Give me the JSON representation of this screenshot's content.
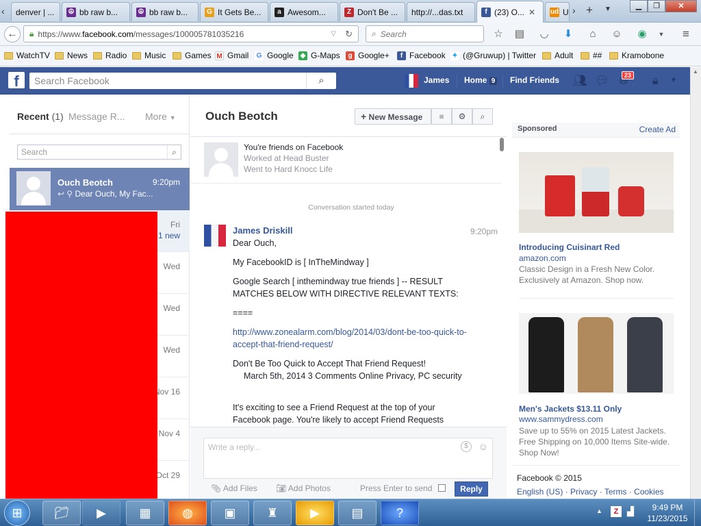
{
  "browser": {
    "tabs": [
      {
        "label": "denver | ...",
        "icon": "page-icon",
        "color": "#e06b2a"
      },
      {
        "label": "bb raw b...",
        "icon": "peace-icon",
        "color": "#6a2c91"
      },
      {
        "label": "bb raw b...",
        "icon": "peace-icon",
        "color": "#6a2c91"
      },
      {
        "label": "It Gets Be...",
        "icon": "g-icon",
        "color": "#e8a11c"
      },
      {
        "label": "Awesom...",
        "icon": "amazon-icon",
        "color": "#222222"
      },
      {
        "label": "Don't Be ...",
        "icon": "z-icon",
        "color": "#c0272d"
      },
      {
        "label": "http://...das.txt",
        "icon": "page-icon",
        "color": "#777777"
      },
      {
        "label": "(23) O...",
        "icon": "facebook-icon",
        "color": "#3b5998"
      },
      {
        "label": "U",
        "icon": "ud-icon",
        "color": "#f08a00"
      }
    ],
    "url_prefix": "https://www.",
    "url_domain": "facebook.com",
    "url_path": "/messages/100005781035216",
    "search_placeholder": "Search",
    "bookmarks": [
      {
        "label": "WatchTV",
        "icon": "folder-icon"
      },
      {
        "label": "News",
        "icon": "folder-icon"
      },
      {
        "label": "Radio",
        "icon": "folder-icon"
      },
      {
        "label": "Music",
        "icon": "folder-icon"
      },
      {
        "label": "Games",
        "icon": "folder-icon"
      },
      {
        "label": "Gmail",
        "icon": "gmail-icon"
      },
      {
        "label": "Google",
        "icon": "google-icon"
      },
      {
        "label": "G-Maps",
        "icon": "maps-icon"
      },
      {
        "label": "Google+",
        "icon": "gplus-icon"
      },
      {
        "label": "Facebook",
        "icon": "facebook-icon"
      },
      {
        "label": "(@Gruwup) | Twitter",
        "icon": "twitter-icon"
      },
      {
        "label": "Adult",
        "icon": "folder-icon"
      },
      {
        "label": "##",
        "icon": "folder-icon"
      },
      {
        "label": "Kramobone",
        "icon": "folder-icon"
      }
    ]
  },
  "facebook": {
    "search_placeholder": "Search Facebook",
    "user_name": "James",
    "home_label": "Home",
    "home_count": "9",
    "find_friends_label": "Find Friends",
    "notification_count": "23"
  },
  "messages_sidebar": {
    "tab_recent": "Recent",
    "recent_count": "(1)",
    "tab_requests": "Message R...",
    "tab_more": "More",
    "search_placeholder": "Search",
    "active_thread": {
      "name": "Ouch Beotch",
      "time": "9:20pm",
      "preview": "Dear Ouch, My Fac..."
    },
    "threads": [
      {
        "time": "Fri",
        "extra": "1 new"
      },
      {
        "time": "Wed",
        "extra": ""
      },
      {
        "time": "Wed",
        "extra": ""
      },
      {
        "time": "Wed",
        "extra": ""
      },
      {
        "time": "Nov 16",
        "extra": ""
      },
      {
        "time": "Nov 4",
        "extra": ""
      },
      {
        "time": "Oct 29",
        "extra": ""
      }
    ]
  },
  "conversation": {
    "title": "Ouch Beotch",
    "new_message_label": "New Message",
    "profile_line1": "You're friends on Facebook",
    "profile_line2": "Worked at Head Buster",
    "profile_line3": "Went to Hard Knocc Life",
    "started_label": "Conversation started today",
    "sender": "James Driskill",
    "sent_time": "9:20pm",
    "paragraphs": [
      "Dear Ouch,",
      "My FacebookID is [ InTheMindway ]",
      "Google Search [ inthemindway true friends ] -- RESULT MATCHES BELOW WITH DIRECTIVE RELEVANT TEXTS:",
      "====",
      "http://www.zonealarm.com/blog/2014/03/dont-be-too-quick-to-accept-that-friend-request/",
      "Don't Be Too Quick to Accept That Friend Request!",
      "March 5th, 2014 3 Comments Online Privacy, PC security",
      "It's exciting to see a Friend Request at the top of your Facebook page. You're likely to accept Friend Requests"
    ],
    "reply_placeholder": "Write a reply...",
    "add_files_label": "Add Files",
    "add_photos_label": "Add Photos",
    "enter_to_send_label": "Press Enter to send",
    "reply_button": "Reply"
  },
  "sponsored": {
    "heading": "Sponsored",
    "create_ad": "Create Ad",
    "ads": [
      {
        "title": "Introducing Cuisinart Red",
        "source": "amazon.com",
        "text": "Classic Design in a Fresh New Color. Exclusively at Amazon. Shop now."
      },
      {
        "title": "Men's Jackets $13.11 Only",
        "source": "www.sammydress.com",
        "text": "Save up to 55% on 2015 Latest Jackets. Free Shipping on 10,000 Items Site-wide. Shop Now!"
      }
    ],
    "footer_copyright": "Facebook © 2015",
    "footer_links": [
      "English (US)",
      "Privacy",
      "Terms",
      "Cookies"
    ]
  },
  "taskbar": {
    "time": "9:49 PM",
    "date": "11/23/2015"
  },
  "colors": {
    "facebook_blue": "#3b5998",
    "link_blue": "#365899",
    "redaction_red": "#ff0000",
    "taskbar_blue": "#2e5f95"
  }
}
